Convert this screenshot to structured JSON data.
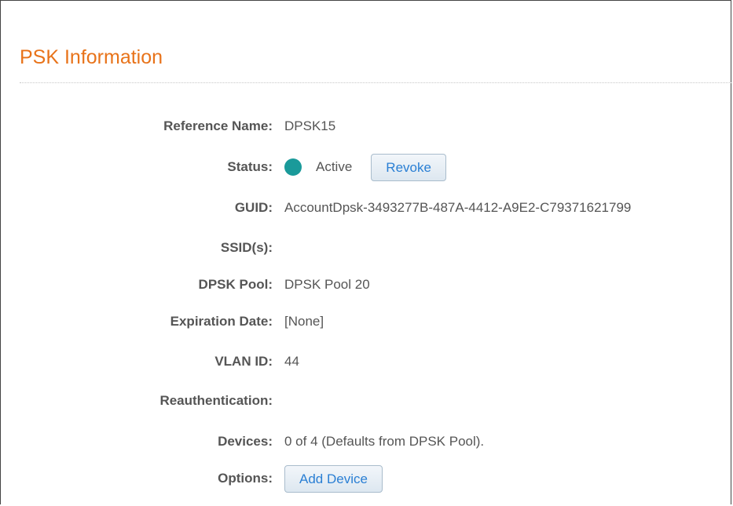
{
  "section": {
    "title": "PSK Information"
  },
  "fields": {
    "reference_name": {
      "label": "Reference Name:",
      "value": "DPSK15"
    },
    "status": {
      "label": "Status:",
      "value": "Active",
      "dot_color": "#1a9a9a",
      "button": "Revoke"
    },
    "guid": {
      "label": "GUID:",
      "value": "AccountDpsk-3493277B-487A-4412-A9E2-C79371621799"
    },
    "ssids": {
      "label": "SSID(s):",
      "value": ""
    },
    "dpsk_pool": {
      "label": "DPSK Pool:",
      "value": "DPSK Pool 20"
    },
    "expiration_date": {
      "label": "Expiration Date:",
      "value": "[None]"
    },
    "vlan_id": {
      "label": "VLAN ID:",
      "value": "44"
    },
    "reauthentication": {
      "label": "Reauthentication:",
      "value": ""
    },
    "devices": {
      "label": "Devices:",
      "value": "0 of 4 (Defaults from DPSK Pool)."
    },
    "options": {
      "label": "Options:",
      "button": "Add Device"
    }
  },
  "colors": {
    "title": "#e8731a",
    "label": "#555555",
    "button_text": "#2a7fd4"
  }
}
